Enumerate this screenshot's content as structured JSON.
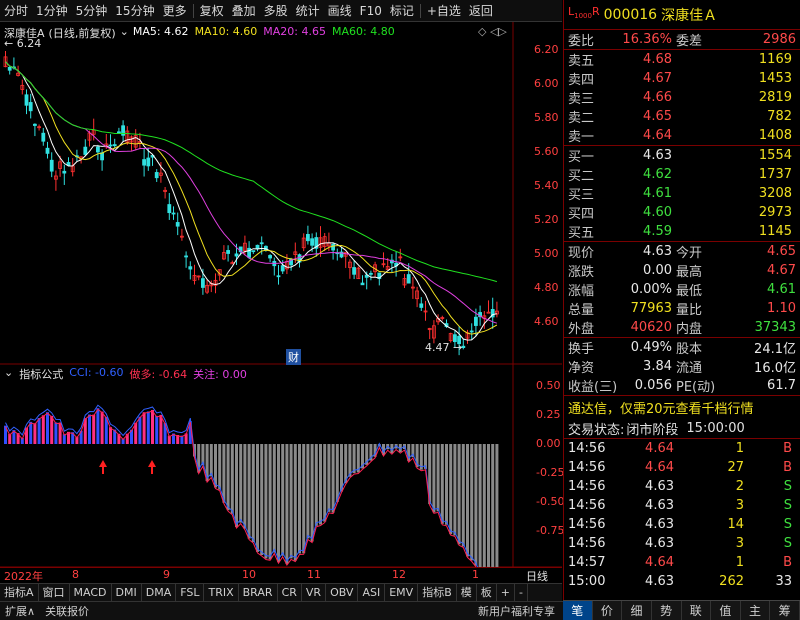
{
  "toolbar": {
    "buttons": [
      "分时",
      "1分钟",
      "5分钟",
      "15分钟",
      "更多",
      "复权",
      "叠加",
      "多股",
      "统计",
      "画线",
      "F10",
      "标记",
      "+自选",
      "返回"
    ]
  },
  "main_chart": {
    "title": "深康佳A",
    "subtitle": "(日线,前复权)",
    "ma_labels": [
      {
        "text": "MA5: 4.62",
        "color": "#ffffff"
      },
      {
        "text": "MA10: 4.60",
        "color": "#f0e020"
      },
      {
        "text": "MA20: 4.65",
        "color": "#e040e0"
      },
      {
        "text": "MA60: 4.80",
        "color": "#20e020"
      }
    ],
    "high_label": "6.24",
    "low_label": "4.47",
    "finance_marker": "财",
    "y_ticks": [
      "6.20",
      "6.00",
      "5.80",
      "5.60",
      "5.40",
      "5.20",
      "5.00",
      "4.80",
      "4.60"
    ]
  },
  "indicator": {
    "title": "指标公式",
    "cci": "CCI: -0.60",
    "long_short": "做多: -0.64",
    "focus": "关注: 0.00",
    "y_ticks": [
      "0.50",
      "0.25",
      "0.00",
      "-0.25",
      "-0.50",
      "-0.75"
    ]
  },
  "x_axis": {
    "labels": [
      "2022年",
      "8",
      "9",
      "10",
      "11",
      "12",
      "1"
    ],
    "period": "日线"
  },
  "tabs": [
    "指标A",
    "窗口",
    "MACD",
    "DMI",
    "DMA",
    "FSL",
    "TRIX",
    "BRAR",
    "CR",
    "VR",
    "OBV",
    "ASI",
    "EMV",
    "指标B",
    "模",
    "板",
    "+",
    "-"
  ],
  "status_bar": [
    "扩展∧",
    "关联报价",
    "新用户福利专享"
  ],
  "quote": {
    "code": "000016",
    "name": "深康佳Ａ",
    "wei_bi_label": "委比",
    "wei_bi": "16.36%",
    "wei_cha_label": "委差",
    "wei_cha": "2986",
    "asks": [
      {
        "label": "卖五",
        "price": "4.68",
        "vol": "1169"
      },
      {
        "label": "卖四",
        "price": "4.67",
        "vol": "1453"
      },
      {
        "label": "卖三",
        "price": "4.66",
        "vol": "2819"
      },
      {
        "label": "卖二",
        "price": "4.65",
        "vol": "782"
      },
      {
        "label": "卖一",
        "price": "4.64",
        "vol": "1408"
      }
    ],
    "bids": [
      {
        "label": "买一",
        "price": "4.63",
        "vol": "1554"
      },
      {
        "label": "买二",
        "price": "4.62",
        "vol": "1737"
      },
      {
        "label": "买三",
        "price": "4.61",
        "vol": "3208"
      },
      {
        "label": "买四",
        "price": "4.60",
        "vol": "2973"
      },
      {
        "label": "买五",
        "price": "4.59",
        "vol": "1145"
      }
    ],
    "stats": [
      {
        "l1": "现价",
        "v1": "4.63",
        "c1": "white",
        "l2": "今开",
        "v2": "4.65",
        "c2": "red"
      },
      {
        "l1": "涨跌",
        "v1": "0.00",
        "c1": "white",
        "l2": "最高",
        "v2": "4.67",
        "c2": "red"
      },
      {
        "l1": "涨幅",
        "v1": "0.00%",
        "c1": "white",
        "l2": "最低",
        "v2": "4.61",
        "c2": "green"
      },
      {
        "l1": "总量",
        "v1": "77963",
        "c1": "yellow",
        "l2": "量比",
        "v2": "1.10",
        "c2": "red"
      },
      {
        "l1": "外盘",
        "v1": "40620",
        "c1": "red",
        "l2": "内盘",
        "v2": "37343",
        "c2": "green"
      }
    ],
    "stats2": [
      {
        "l1": "换手",
        "v1": "0.49%",
        "l2": "股本",
        "v2": "24.1亿"
      },
      {
        "l1": "净资",
        "v1": "3.84",
        "l2": "流通",
        "v2": "16.0亿"
      },
      {
        "l1": "收益(三)",
        "v1": "0.056",
        "l2": "PE(动)",
        "v2": "61.7"
      }
    ],
    "promo": "通达信，仅需20元查看千档行情",
    "trade_state_label": "交易状态:",
    "trade_state": "闭市阶段",
    "trade_time": "15:00:00",
    "ticks": [
      {
        "time": "14:56",
        "price": "4.64",
        "pc": "red",
        "vol": "1",
        "bs": "B"
      },
      {
        "time": "14:56",
        "price": "4.64",
        "pc": "red",
        "vol": "27",
        "bs": "B"
      },
      {
        "time": "14:56",
        "price": "4.63",
        "pc": "white",
        "vol": "2",
        "bs": "S"
      },
      {
        "time": "14:56",
        "price": "4.63",
        "pc": "white",
        "vol": "3",
        "bs": "S"
      },
      {
        "time": "14:56",
        "price": "4.63",
        "pc": "white",
        "vol": "14",
        "bs": "S"
      },
      {
        "time": "14:56",
        "price": "4.63",
        "pc": "white",
        "vol": "3",
        "bs": "S"
      },
      {
        "time": "14:57",
        "price": "4.64",
        "pc": "red",
        "vol": "1",
        "bs": "B"
      },
      {
        "time": "15:00",
        "price": "4.63",
        "pc": "white",
        "vol": "262",
        "bs": "33"
      }
    ],
    "bottom_tabs": [
      "笔",
      "价",
      "细",
      "势",
      "联",
      "值",
      "主",
      "筹"
    ]
  }
}
